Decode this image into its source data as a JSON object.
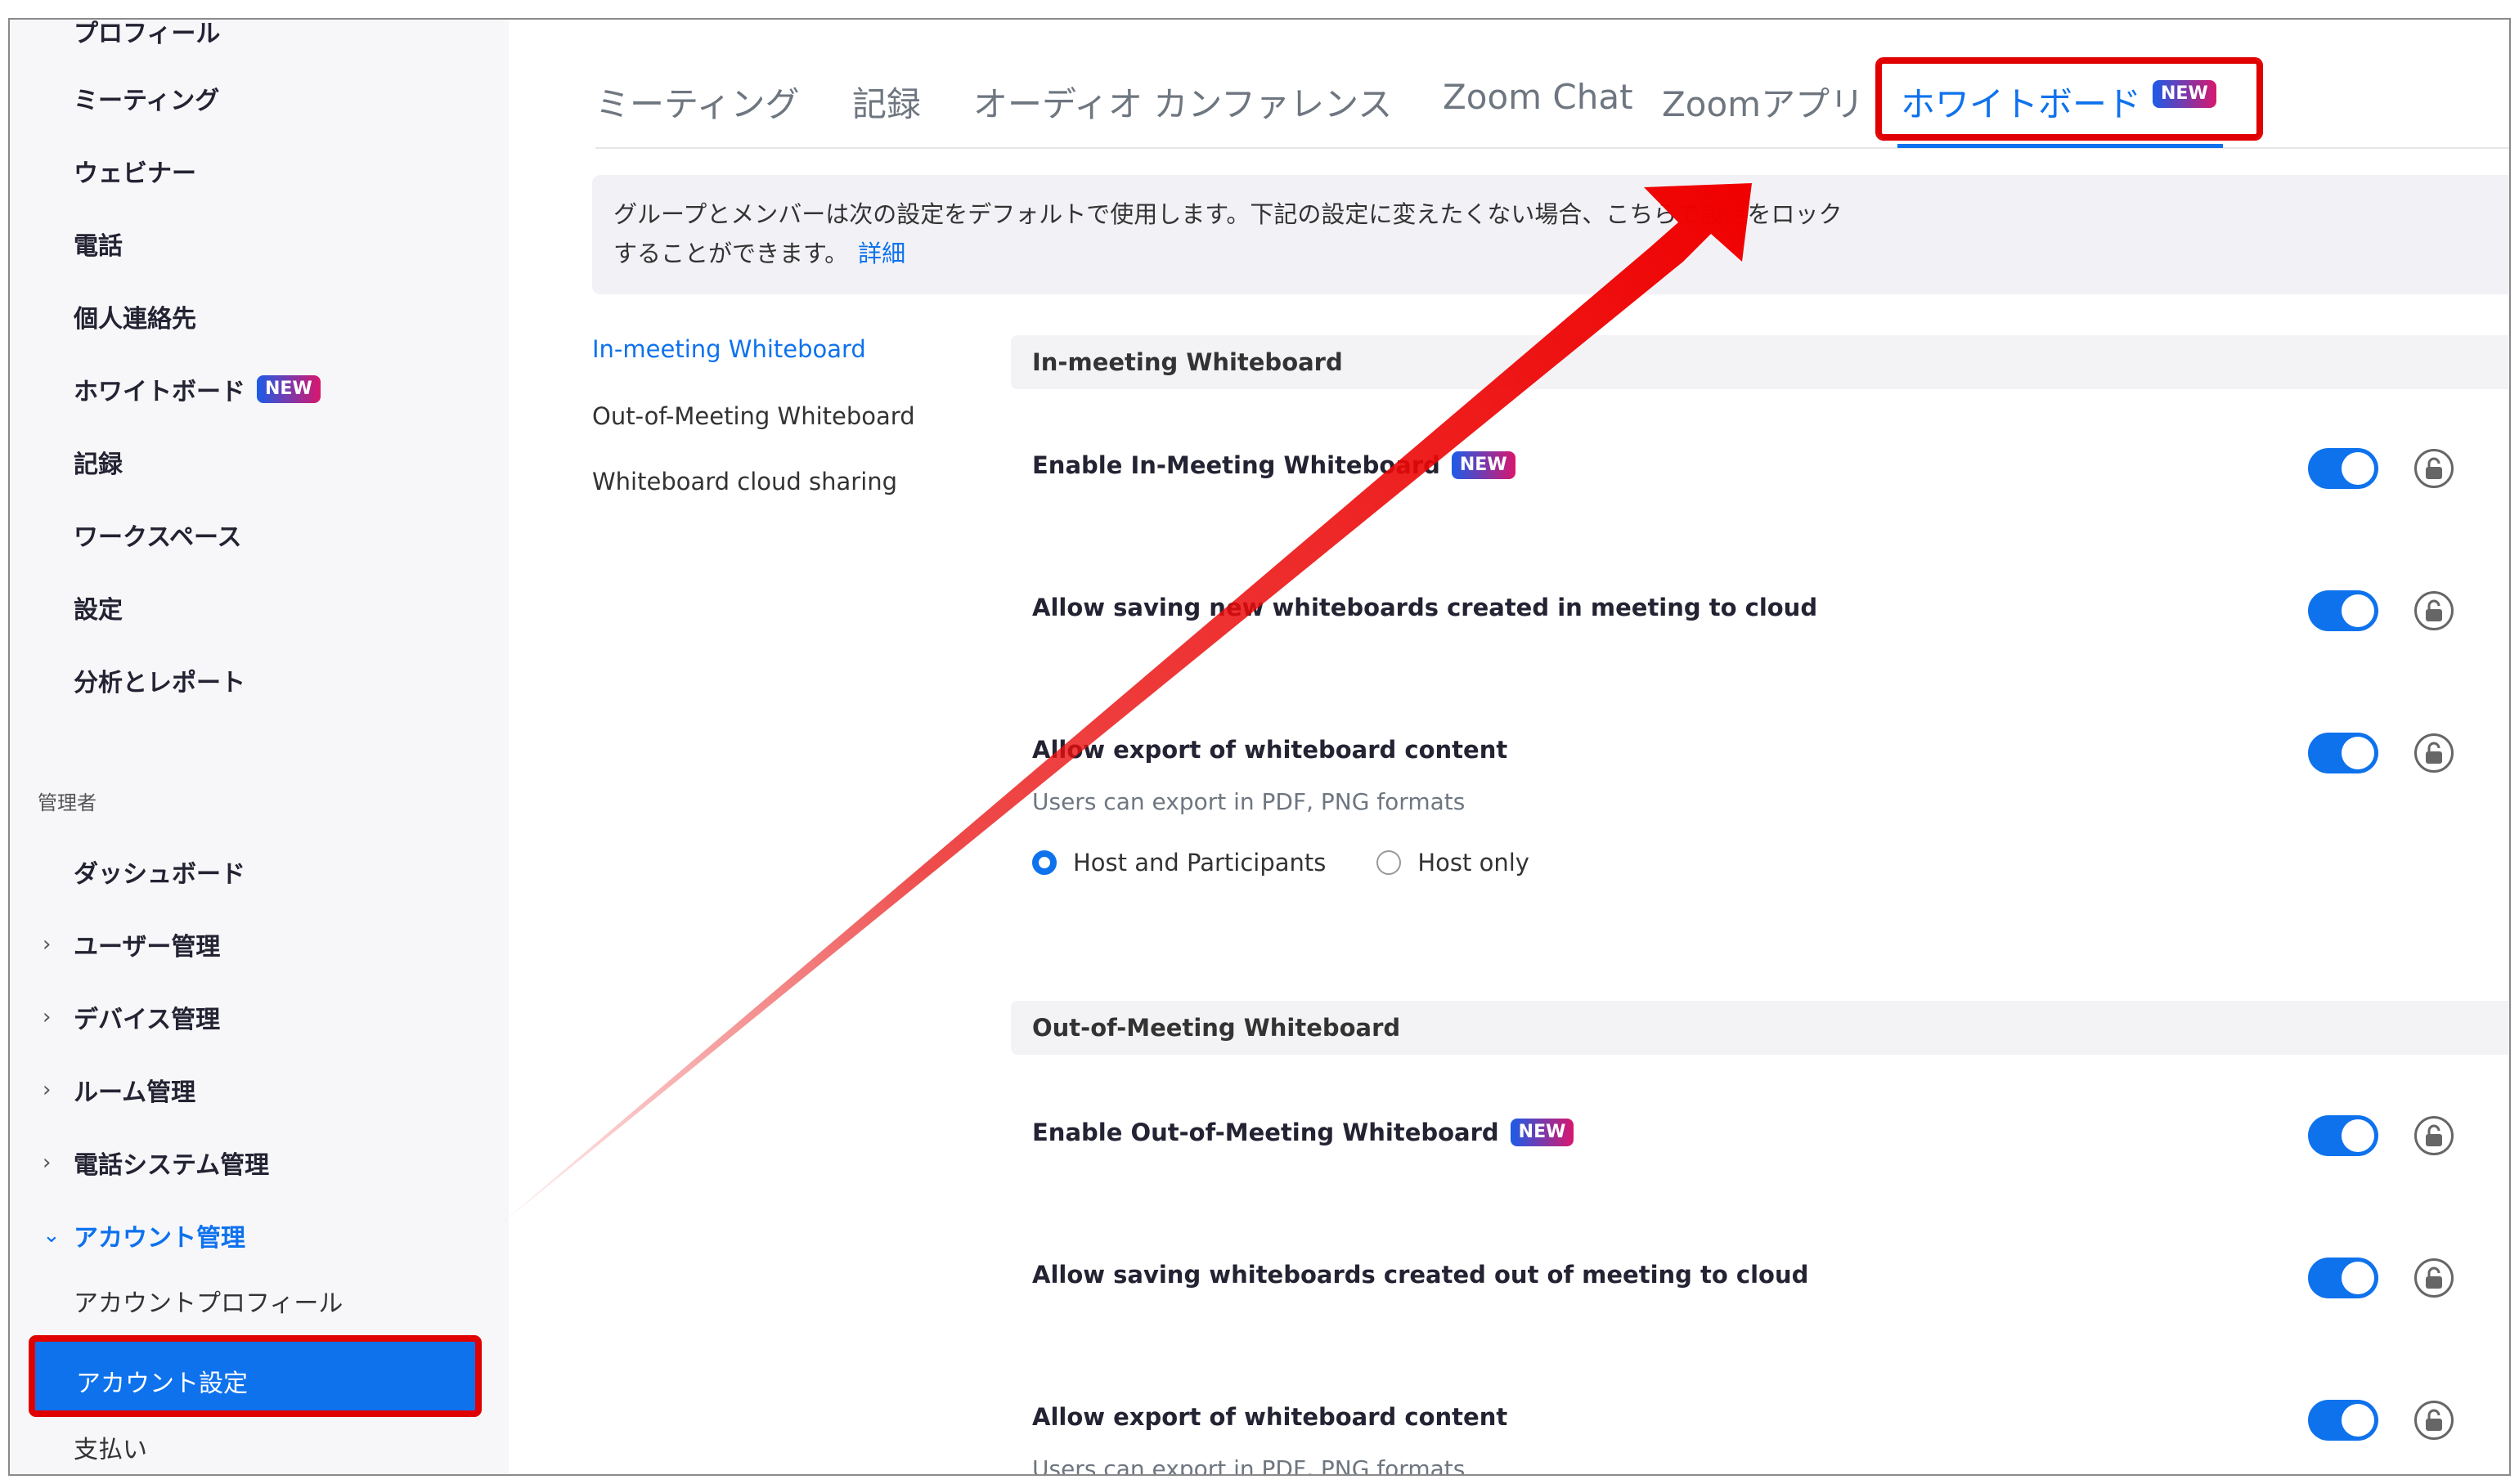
{
  "sidebar": {
    "items": [
      {
        "label": "プロフィール"
      },
      {
        "label": "ミーティング"
      },
      {
        "label": "ウェビナー"
      },
      {
        "label": "電話"
      },
      {
        "label": "個人連絡先"
      },
      {
        "label": "ホワイトボード",
        "badge": "NEW"
      },
      {
        "label": "記録"
      },
      {
        "label": "ワークスペース"
      },
      {
        "label": "設定"
      },
      {
        "label": "分析とレポート"
      }
    ],
    "admin_label": "管理者",
    "admin_items": [
      {
        "label": "ダッシュボード"
      },
      {
        "label": "ユーザー管理"
      },
      {
        "label": "デバイス管理"
      },
      {
        "label": "ルーム管理"
      },
      {
        "label": "電話システム管理"
      },
      {
        "label": "アカウント管理"
      },
      {
        "label": "アカウントプロフィール"
      },
      {
        "label": "アカウント設定"
      },
      {
        "label": "支払い"
      }
    ]
  },
  "tabs": [
    {
      "label": "ミーティング"
    },
    {
      "label": "記録"
    },
    {
      "label": "オーディオ カンファレンス"
    },
    {
      "label": "Zoom Chat"
    },
    {
      "label": "Zoomアプリ"
    },
    {
      "label": "ホワイトボード",
      "badge": "NEW",
      "active": true
    }
  ],
  "notice": {
    "text": "グループとメンバーは次の設定をデフォルトで使用します。下記の設定に変えたくない場合、こちらで設定をロックすることができます。",
    "link": "詳細"
  },
  "anchors": [
    {
      "label": "In-meeting Whiteboard"
    },
    {
      "label": "Out-of-Meeting Whiteboard"
    },
    {
      "label": "Whiteboard cloud sharing"
    }
  ],
  "groups": [
    {
      "title": "In-meeting Whiteboard",
      "settings": [
        {
          "title": "Enable In-Meeting Whiteboard",
          "badge": "NEW",
          "enabled": true
        },
        {
          "title": "Allow saving new whiteboards created in meeting to cloud",
          "enabled": true
        },
        {
          "title": "Allow export of whiteboard content",
          "desc": "Users can export in PDF, PNG formats",
          "enabled": true,
          "options": [
            {
              "label": "Host and Participants",
              "selected": true
            },
            {
              "label": "Host only",
              "selected": false
            }
          ]
        }
      ]
    },
    {
      "title": "Out-of-Meeting Whiteboard",
      "settings": [
        {
          "title": "Enable Out-of-Meeting Whiteboard",
          "badge": "NEW",
          "enabled": true
        },
        {
          "title": "Allow saving whiteboards created out of meeting to cloud",
          "enabled": true
        },
        {
          "title": "Allow export of whiteboard content",
          "desc": "Users can export in PDF, PNG formats",
          "enabled": true
        }
      ]
    }
  ],
  "colors": {
    "accent": "#0e72ed",
    "highlight": "#e00000",
    "sidebar_bg": "#f7f7fa"
  },
  "icons": [
    "chevron-right-icon",
    "chevron-down-icon",
    "lock-icon",
    "annotation-arrow"
  ]
}
